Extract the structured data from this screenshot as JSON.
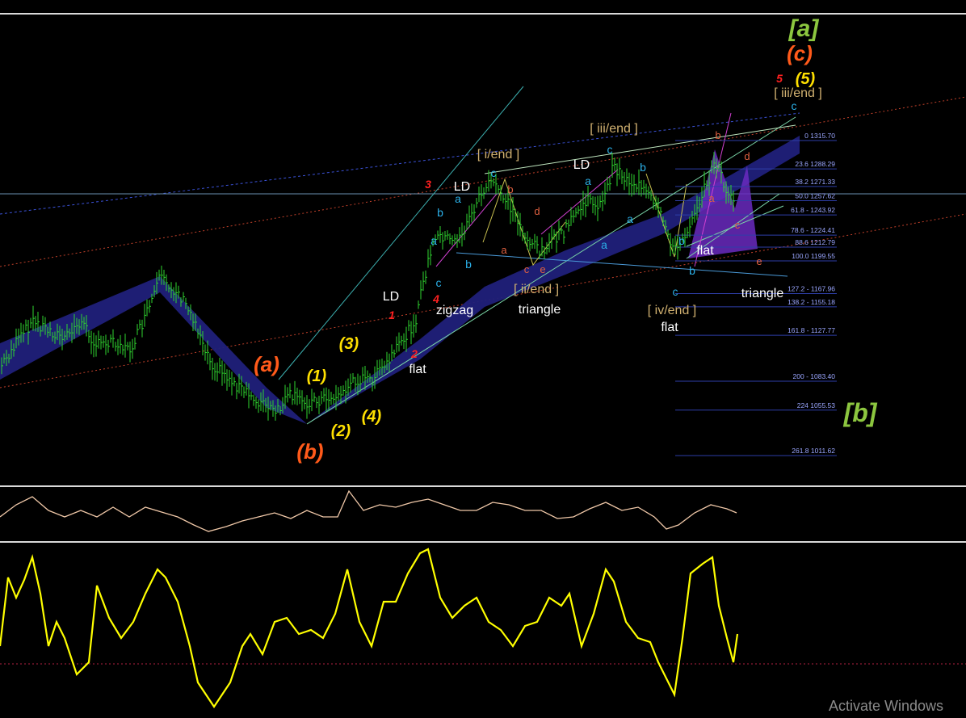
{
  "watermark": "Activate Windows",
  "colors": {
    "background": "#000000",
    "bars": "#2fd62f",
    "channel_fill": "#20207a",
    "osc1": "#f0c8a8",
    "osc2": "#ffff00",
    "fib_line": "#2e3ea8",
    "fib_text": "#9aa6ff"
  },
  "chart_data": [
    {
      "type": "line",
      "name": "price_with_elliott_wave_annotations",
      "fib_levels": [
        {
          "label": "0 1315.70",
          "pct": 0,
          "price": 1315.7
        },
        {
          "label": "23.6 1288.29",
          "pct": 23.6,
          "price": 1288.29
        },
        {
          "label": "38.2 1271.33",
          "pct": 38.2,
          "price": 1271.33
        },
        {
          "label": "50.0 1257.62",
          "pct": 50.0,
          "price": 1257.62
        },
        {
          "label": "61.8 - 1243.92",
          "pct": 61.8,
          "price": 1243.92
        },
        {
          "label": "78.6 - 1224.41",
          "pct": 78.6,
          "price": 1224.41
        },
        {
          "label": "88.6 1212.79",
          "pct": 88.6,
          "price": 1212.79
        },
        {
          "label": "100.0 1199.55",
          "pct": 100.0,
          "price": 1199.55
        },
        {
          "label": "127.2 - 1167.96",
          "pct": 127.2,
          "price": 1167.96
        },
        {
          "label": "138.2 - 1155.18",
          "pct": 138.2,
          "price": 1155.18
        },
        {
          "label": "161.8 - 1127.77",
          "pct": 161.8,
          "price": 1127.77
        },
        {
          "label": "200 - 1083.40",
          "pct": 200,
          "price": 1083.4
        },
        {
          "label": "224 1055.53",
          "pct": 224,
          "price": 1055.53
        },
        {
          "label": "261.8 1011.62",
          "pct": 261.8,
          "price": 1011.62
        }
      ],
      "wave_labels": {
        "major": [
          "[a]",
          "[b]",
          "(a)",
          "(b)",
          "(c)"
        ],
        "intermediate": [
          "(1)",
          "(2)",
          "(3)",
          "(4)",
          "(5)"
        ],
        "minor": [
          "1",
          "2",
          "3",
          "4",
          "5"
        ],
        "structure": [
          "[ i/end ]",
          "[ ii/end ]",
          "[ iii/end ]",
          "[ iv/end ]",
          "[ iii/end ]"
        ],
        "patterns": [
          "LD",
          "LD",
          "LD",
          "zigzag",
          "triangle",
          "flat",
          "flat",
          "flat",
          "triangle"
        ]
      },
      "price_path": [
        [
          0,
          455
        ],
        [
          20,
          425
        ],
        [
          40,
          398
        ],
        [
          60,
          408
        ],
        [
          80,
          420
        ],
        [
          100,
          398
        ],
        [
          120,
          428
        ],
        [
          140,
          420
        ],
        [
          160,
          435
        ],
        [
          178,
          398
        ],
        [
          198,
          345
        ],
        [
          220,
          362
        ],
        [
          240,
          395
        ],
        [
          262,
          450
        ],
        [
          285,
          470
        ],
        [
          305,
          488
        ],
        [
          325,
          500
        ],
        [
          342,
          512
        ],
        [
          358,
          490
        ],
        [
          378,
          498
        ],
        [
          400,
          494
        ],
        [
          420,
          490
        ],
        [
          440,
          470
        ],
        [
          460,
          470
        ],
        [
          480,
          450
        ],
        [
          500,
          420
        ],
        [
          515,
          395
        ],
        [
          525,
          345
        ],
        [
          535,
          305
        ],
        [
          545,
          290
        ],
        [
          560,
          300
        ],
        [
          575,
          285
        ],
        [
          595,
          240
        ],
        [
          610,
          225
        ],
        [
          625,
          245
        ],
        [
          640,
          272
        ],
        [
          655,
          300
        ],
        [
          670,
          310
        ],
        [
          685,
          298
        ],
        [
          700,
          285
        ],
        [
          715,
          260
        ],
        [
          730,
          248
        ],
        [
          745,
          255
        ],
        [
          760,
          205
        ],
        [
          775,
          222
        ],
        [
          790,
          230
        ],
        [
          805,
          245
        ],
        [
          820,
          270
        ],
        [
          835,
          310
        ],
        [
          845,
          300
        ],
        [
          858,
          265
        ],
        [
          872,
          235
        ],
        [
          886,
          200
        ],
        [
          898,
          232
        ],
        [
          910,
          258
        ]
      ],
      "osc1_path": [
        [
          0,
          640
        ],
        [
          20,
          625
        ],
        [
          40,
          615
        ],
        [
          60,
          632
        ],
        [
          80,
          640
        ],
        [
          100,
          632
        ],
        [
          120,
          640
        ],
        [
          140,
          628
        ],
        [
          160,
          640
        ],
        [
          180,
          628
        ],
        [
          200,
          634
        ],
        [
          220,
          640
        ],
        [
          240,
          650
        ],
        [
          258,
          658
        ],
        [
          280,
          652
        ],
        [
          300,
          645
        ],
        [
          320,
          640
        ],
        [
          340,
          635
        ],
        [
          360,
          642
        ],
        [
          380,
          632
        ],
        [
          400,
          640
        ],
        [
          418,
          640
        ],
        [
          432,
          608
        ],
        [
          450,
          632
        ],
        [
          470,
          625
        ],
        [
          490,
          628
        ],
        [
          510,
          622
        ],
        [
          530,
          618
        ],
        [
          550,
          625
        ],
        [
          570,
          632
        ],
        [
          590,
          632
        ],
        [
          610,
          622
        ],
        [
          630,
          625
        ],
        [
          650,
          632
        ],
        [
          670,
          632
        ],
        [
          690,
          642
        ],
        [
          710,
          640
        ],
        [
          730,
          630
        ],
        [
          750,
          622
        ],
        [
          770,
          632
        ],
        [
          790,
          628
        ],
        [
          810,
          640
        ],
        [
          825,
          655
        ],
        [
          840,
          650
        ],
        [
          860,
          635
        ],
        [
          880,
          625
        ],
        [
          900,
          630
        ],
        [
          912,
          635
        ]
      ],
      "osc2_path": [
        [
          0,
          800
        ],
        [
          10,
          715
        ],
        [
          20,
          740
        ],
        [
          30,
          718
        ],
        [
          40,
          690
        ],
        [
          50,
          735
        ],
        [
          60,
          800
        ],
        [
          70,
          770
        ],
        [
          80,
          790
        ],
        [
          95,
          835
        ],
        [
          110,
          820
        ],
        [
          120,
          725
        ],
        [
          135,
          765
        ],
        [
          150,
          790
        ],
        [
          165,
          770
        ],
        [
          180,
          735
        ],
        [
          195,
          705
        ],
        [
          205,
          715
        ],
        [
          220,
          745
        ],
        [
          235,
          800
        ],
        [
          245,
          845
        ],
        [
          265,
          875
        ],
        [
          285,
          845
        ],
        [
          300,
          800
        ],
        [
          310,
          785
        ],
        [
          325,
          810
        ],
        [
          340,
          770
        ],
        [
          355,
          765
        ],
        [
          370,
          785
        ],
        [
          385,
          780
        ],
        [
          400,
          790
        ],
        [
          415,
          760
        ],
        [
          430,
          705
        ],
        [
          445,
          770
        ],
        [
          460,
          800
        ],
        [
          475,
          745
        ],
        [
          490,
          745
        ],
        [
          505,
          710
        ],
        [
          520,
          685
        ],
        [
          530,
          680
        ],
        [
          545,
          740
        ],
        [
          560,
          765
        ],
        [
          575,
          750
        ],
        [
          590,
          740
        ],
        [
          605,
          770
        ],
        [
          620,
          780
        ],
        [
          635,
          800
        ],
        [
          650,
          775
        ],
        [
          665,
          770
        ],
        [
          680,
          740
        ],
        [
          695,
          750
        ],
        [
          705,
          735
        ],
        [
          720,
          800
        ],
        [
          735,
          760
        ],
        [
          750,
          705
        ],
        [
          760,
          720
        ],
        [
          775,
          770
        ],
        [
          790,
          790
        ],
        [
          805,
          795
        ],
        [
          815,
          820
        ],
        [
          825,
          840
        ],
        [
          835,
          860
        ],
        [
          845,
          790
        ],
        [
          855,
          710
        ],
        [
          870,
          698
        ],
        [
          882,
          690
        ],
        [
          890,
          750
        ],
        [
          900,
          790
        ],
        [
          908,
          820
        ],
        [
          913,
          785
        ]
      ]
    }
  ]
}
